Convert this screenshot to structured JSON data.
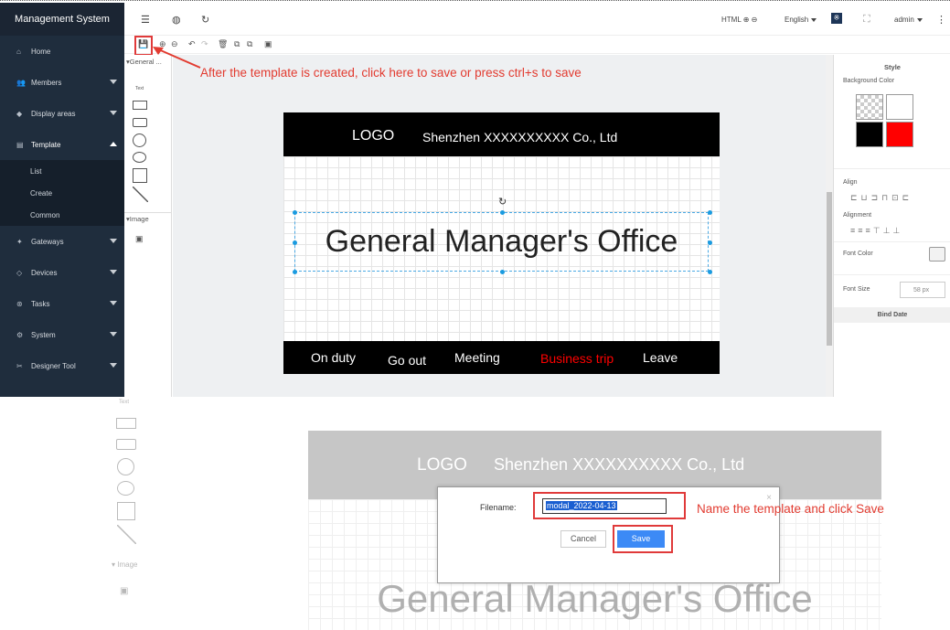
{
  "app": {
    "brand": "Management System"
  },
  "nav": {
    "home": "Home",
    "members": "Members",
    "display_areas": "Display areas",
    "template": "Template",
    "list": "List",
    "create": "Create",
    "common": "Common",
    "gateways": "Gateways",
    "devices": "Devices",
    "tasks": "Tasks",
    "system": "System",
    "designer_tool": "Designer Tool"
  },
  "topbar": {
    "html_mode": "HTML ⊕ ⊖",
    "language": "English",
    "user": "admin"
  },
  "annotations": {
    "save_hint": "After the template is created, click here to save or press ctrl+s to save",
    "name_hint": "Name the template and click Save"
  },
  "palette": {
    "general": "General ...",
    "text": "Text",
    "image": "Image"
  },
  "board": {
    "logo": "LOGO",
    "company": "Shenzhen XXXXXXXXXX Co., Ltd",
    "title": "General Manager's Office",
    "statuses": [
      {
        "label": "On duty",
        "color": "#ffffff"
      },
      {
        "label": "Go out",
        "color": "#ffffff"
      },
      {
        "label": "Meeting",
        "color": "#ffffff"
      },
      {
        "label": "Business trip",
        "color": "#ff0000"
      },
      {
        "label": "Leave",
        "color": "#ffffff"
      }
    ]
  },
  "style_panel": {
    "title": "Style",
    "background_color": "Background Color",
    "align": "Align",
    "alignment": "Alignment",
    "font_color": "Font Color",
    "font_size": "Font Size",
    "font_size_value": "58",
    "font_size_unit": "px",
    "bind_date": "Bind Date",
    "swatches": [
      "transparent",
      "#ffffff",
      "#000000",
      "#ff0000"
    ]
  },
  "modal": {
    "filename_label": "Filename:",
    "filename_value": "modal_2022-04-13",
    "cancel": "Cancel",
    "save": "Save",
    "close": "×"
  },
  "colors": {
    "sidebar": "#1f2d3d",
    "accent": "#3c8af6",
    "annotation": "#e23b30"
  }
}
